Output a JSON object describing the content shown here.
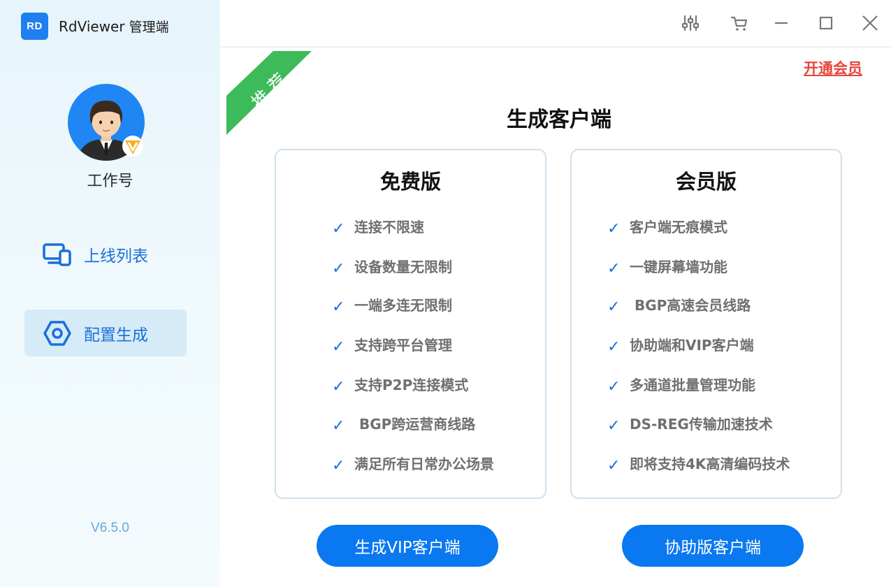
{
  "app": {
    "logo_text": "RD",
    "title": "RdViewer",
    "subtitle": "管理端",
    "brand_color": "#1f7ff0"
  },
  "window_controls": [
    "settings-sliders-icon",
    "cart-icon",
    "minimize-icon",
    "maximize-icon",
    "close-icon"
  ],
  "profile": {
    "name": "工作号",
    "badge": "V"
  },
  "sidebar": {
    "items": [
      {
        "label": "上线列表",
        "icon": "devices-icon",
        "active": false
      },
      {
        "label": "配置生成",
        "icon": "hexagon-settings-icon",
        "active": true
      }
    ],
    "version": "V6.5.0"
  },
  "main": {
    "ribbon": "推 荐",
    "vip_link": "开通会员",
    "title": "生成客户端",
    "free": {
      "title": "免费版",
      "features": [
        "连接不限速",
        "设备数量无限制",
        "一端多连无限制",
        "支持跨平台管理",
        "支持P2P连接模式",
        " BGP跨运营商线路",
        "满足所有日常办公场景"
      ]
    },
    "vip": {
      "title": "会员版",
      "features": [
        "客户端无痕模式",
        "一键屏幕墙功能",
        " BGP高速会员线路",
        "协助端和VIP客户端",
        "多通道批量管理功能",
        "DS-REG传输加速技术",
        "即将支持4K高清编码技术"
      ]
    },
    "buttons": {
      "vip_client": "生成VIP客户端",
      "assist_client": "协助版客户端"
    }
  },
  "colors": {
    "accent": "#0a78f0",
    "ribbon_green": "#3dbb5a",
    "vip_link": "#e8453c",
    "check": "#1a6fd8"
  }
}
